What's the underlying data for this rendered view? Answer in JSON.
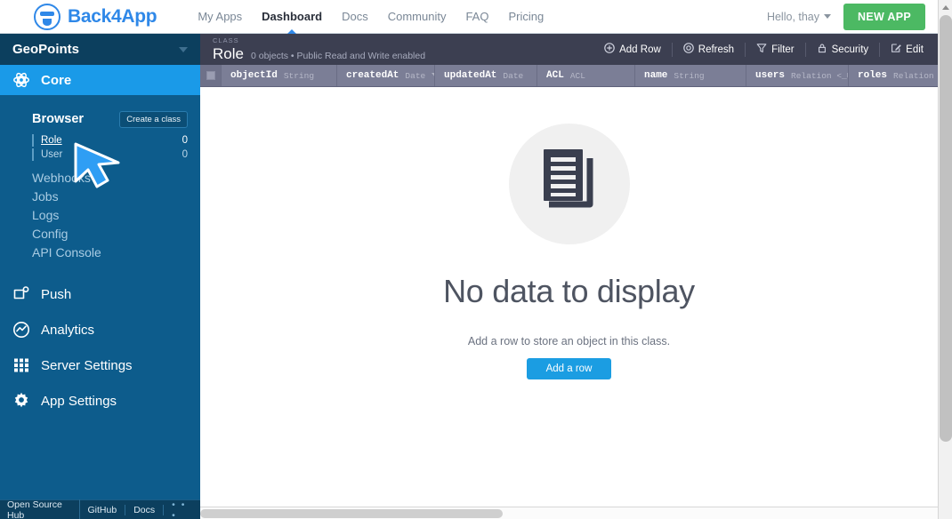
{
  "topnav": {
    "brand": "Back4App",
    "brand_icon": "back4app-logo-icon",
    "links": [
      {
        "label": "My Apps",
        "active": false
      },
      {
        "label": "Dashboard",
        "active": true
      },
      {
        "label": "Docs",
        "active": false
      },
      {
        "label": "Community",
        "active": false
      },
      {
        "label": "FAQ",
        "active": false
      },
      {
        "label": "Pricing",
        "active": false
      }
    ],
    "user_greeting": "Hello, thay",
    "new_app_label": "NEW APP",
    "new_app_color": "#4cb963",
    "brand_color": "#2f88e8"
  },
  "sidebar": {
    "app_name": "GeoPoints",
    "core_section": "Core",
    "browser_title": "Browser",
    "create_class_label": "Create a class",
    "classes": [
      {
        "name": "Role",
        "count": "0",
        "selected": true
      },
      {
        "name": "User",
        "count": "0",
        "selected": false
      }
    ],
    "nav_items": [
      {
        "label": "Webhooks"
      },
      {
        "label": "Jobs"
      },
      {
        "label": "Logs"
      },
      {
        "label": "Config"
      },
      {
        "label": "API Console"
      }
    ],
    "sections": [
      {
        "label": "Push",
        "icon": "push-icon"
      },
      {
        "label": "Analytics",
        "icon": "analytics-icon"
      },
      {
        "label": "Server Settings",
        "icon": "grid-icon"
      },
      {
        "label": "App Settings",
        "icon": "gear-icon"
      }
    ],
    "footer_links": [
      "Open Source Hub",
      "GitHub",
      "Docs"
    ],
    "footer_more": "• • •",
    "bg_color": "#0d5c8c",
    "accent_color": "#1a9ae8"
  },
  "main": {
    "class_kicker": "CLASS",
    "class_name": "Role",
    "class_stats": "0 objects • Public Read and Write enabled",
    "toolbar": [
      {
        "label": "Add Row",
        "icon": "plus-circle-icon"
      },
      {
        "label": "Refresh",
        "icon": "refresh-icon"
      },
      {
        "label": "Filter",
        "icon": "funnel-icon"
      },
      {
        "label": "Security",
        "icon": "lock-icon"
      },
      {
        "label": "Edit",
        "icon": "pencil-icon"
      }
    ],
    "columns": [
      {
        "name": "objectId",
        "type": "String",
        "width": 130,
        "sorted": false
      },
      {
        "name": "createdAt",
        "type": "Date",
        "width": 110,
        "sorted": true
      },
      {
        "name": "updatedAt",
        "type": "Date",
        "width": 115,
        "sorted": false
      },
      {
        "name": "ACL",
        "type": "ACL",
        "width": 110,
        "sorted": false
      },
      {
        "name": "name",
        "type": "String",
        "width": 125,
        "sorted": false
      },
      {
        "name": "users",
        "type": "Relation <_Use…",
        "width": 115,
        "sorted": false
      },
      {
        "name": "roles",
        "type": "Relation <_Rol…",
        "width": 115,
        "sorted": false
      }
    ],
    "empty": {
      "icon": "documents-icon",
      "title": "No data to display",
      "subtitle": "Add a row to store an object in this class.",
      "button_label": "Add a row",
      "button_color": "#1b9de2"
    }
  },
  "cursor": {
    "icon": "arrow-pointer-cursor"
  }
}
